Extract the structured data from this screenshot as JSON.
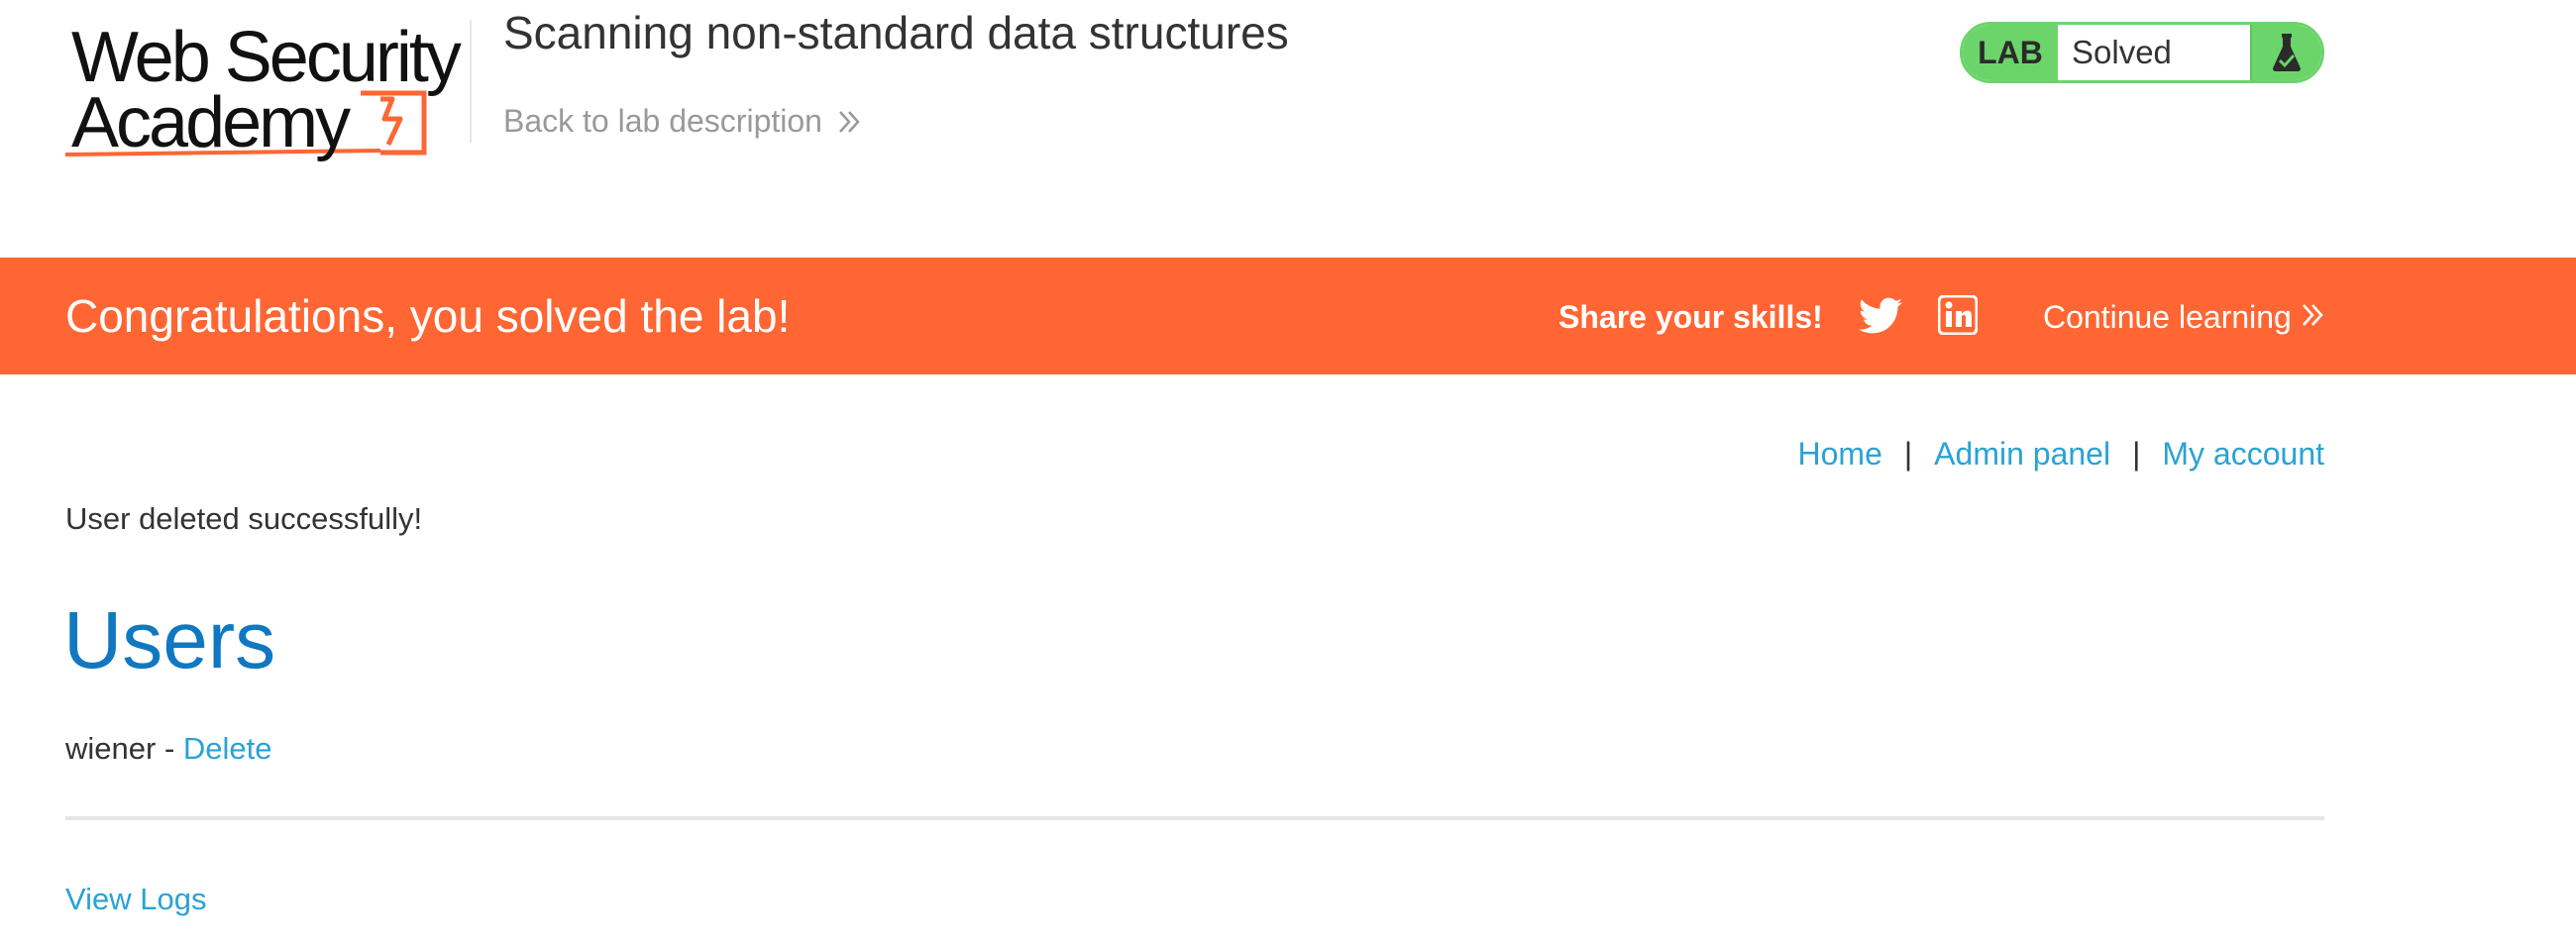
{
  "header": {
    "logo_line1": "Web Security",
    "logo_line2": "Academy",
    "lab_title": "Scanning non-standard data structures",
    "back_link": "Back to lab description",
    "lab_tag": "LAB",
    "lab_status": "Solved",
    "status_color": "#6bd46b"
  },
  "banner": {
    "message": "Congratulations, you solved the lab!",
    "share_label": "Share your skills!",
    "continue_link": "Continue learning",
    "icons": [
      "twitter-icon",
      "linkedin-icon"
    ],
    "background": "#ff6633"
  },
  "nav": {
    "home": "Home",
    "separator": "|",
    "admin_panel": "Admin panel",
    "my_account": "My account"
  },
  "main": {
    "notice": "User deleted successfully!",
    "heading": "Users",
    "users": [
      {
        "name": "wiener",
        "separator": " - ",
        "action": "Delete"
      }
    ],
    "view_logs": "View Logs",
    "link_color": "#29a3d4",
    "heading_color": "#0f78c1"
  }
}
